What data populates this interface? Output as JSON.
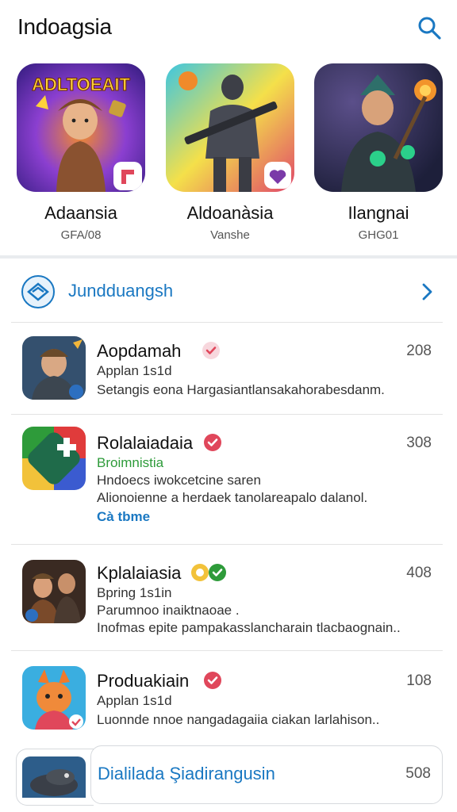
{
  "header": {
    "title": "Indoagsia"
  },
  "featured": [
    {
      "banner_text": "ADLTOEAIT",
      "name": "Adaansia",
      "sub": "GFA/08"
    },
    {
      "name": "Aldoanàsia",
      "sub": "Vanshe"
    },
    {
      "name": "Ilangnai",
      "sub": "GHG01"
    }
  ],
  "section": {
    "label": "Jundduangsh"
  },
  "rows": [
    {
      "name": "Aopdamah",
      "count": "208",
      "lines": [
        "Applan 1s1d",
        "Setangis eona Hargasiantlansakahorabesdanm."
      ]
    },
    {
      "name": "Rolalaiadaia",
      "count": "308",
      "lines": [
        "Broimnistia",
        "Hndoecs iwokcetcine saren",
        "Alionoienne a herdaek tanolareapalo dalanol."
      ],
      "link": "Cà tbme"
    },
    {
      "name": "Kplalaiasia",
      "count": "408",
      "lines": [
        "Bpring 1s1in",
        "Parumnoo inaiktnaoae .",
        "Inofmas epite pampakasslancharain tlacbaognain.."
      ]
    },
    {
      "name": "Produakiain",
      "count": "108",
      "lines": [
        "Applan 1s1d",
        "Luonnde nnoe nangadagaiia ciakan larlahison.."
      ]
    }
  ],
  "bottom": {
    "label": "Dialilada Şiadirangusin",
    "count": "508"
  },
  "colors": {
    "accent": "#1a78c2",
    "green": "#2e9b3a",
    "verify_red": "#e0475b"
  }
}
